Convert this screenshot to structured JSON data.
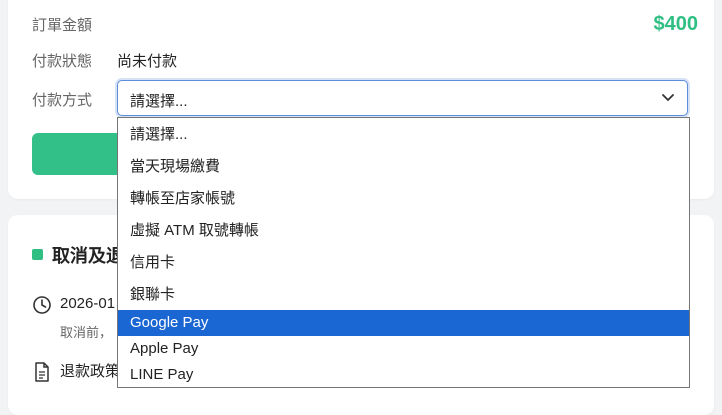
{
  "order": {
    "amount_label": "訂單金額",
    "amount_value": "$400",
    "status_label": "付款狀態",
    "status_value": "尚未付款",
    "method_label": "付款方式",
    "method_selected": "請選擇..."
  },
  "dropdown": {
    "options": [
      "請選擇...",
      "當天現場繳費",
      "轉帳至店家帳號",
      "虛擬 ATM 取號轉帳",
      "信用卡",
      "銀聯卡",
      "Google Pay",
      "Apple Pay",
      "LINE Pay"
    ],
    "highlighted": "Google Pay"
  },
  "cancel_section": {
    "title": "取消及退",
    "date": "2026-01",
    "note": "取消前，",
    "policy": "退款政策"
  },
  "colors": {
    "accent_green": "#2fbf83",
    "highlight_blue": "#1a66d2"
  },
  "icons": {
    "select_chevron": "chevron-down-icon",
    "clock": "clock-icon",
    "document": "document-icon"
  }
}
